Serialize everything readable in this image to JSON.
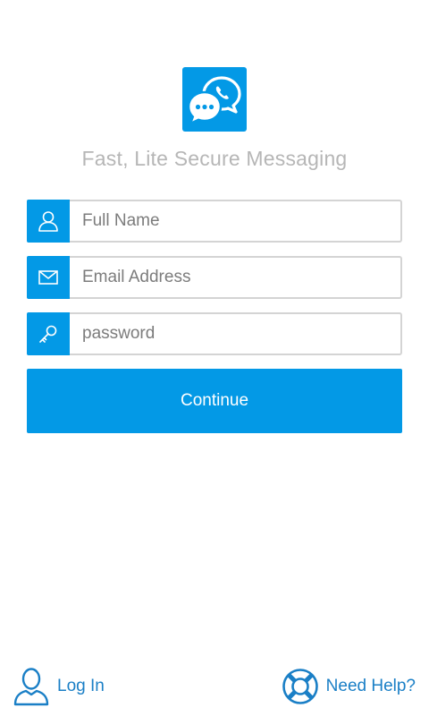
{
  "app": {
    "tagline": "Fast, Lite Secure Messaging",
    "logo_icon": "chat-bubbles-icon",
    "accent_color": "#0399e6"
  },
  "form": {
    "full_name": {
      "value": "",
      "placeholder": "Full Name",
      "icon": "user-icon"
    },
    "email": {
      "value": "",
      "placeholder": "Email Address",
      "icon": "envelope-icon"
    },
    "password": {
      "value": "",
      "placeholder": "password",
      "icon": "key-icon"
    },
    "continue_label": "Continue"
  },
  "footer": {
    "login_label": "Log In",
    "login_icon": "user-outline-icon",
    "help_label": "Need Help?",
    "help_icon": "lifebuoy-icon",
    "link_color": "#1a7fc6"
  }
}
